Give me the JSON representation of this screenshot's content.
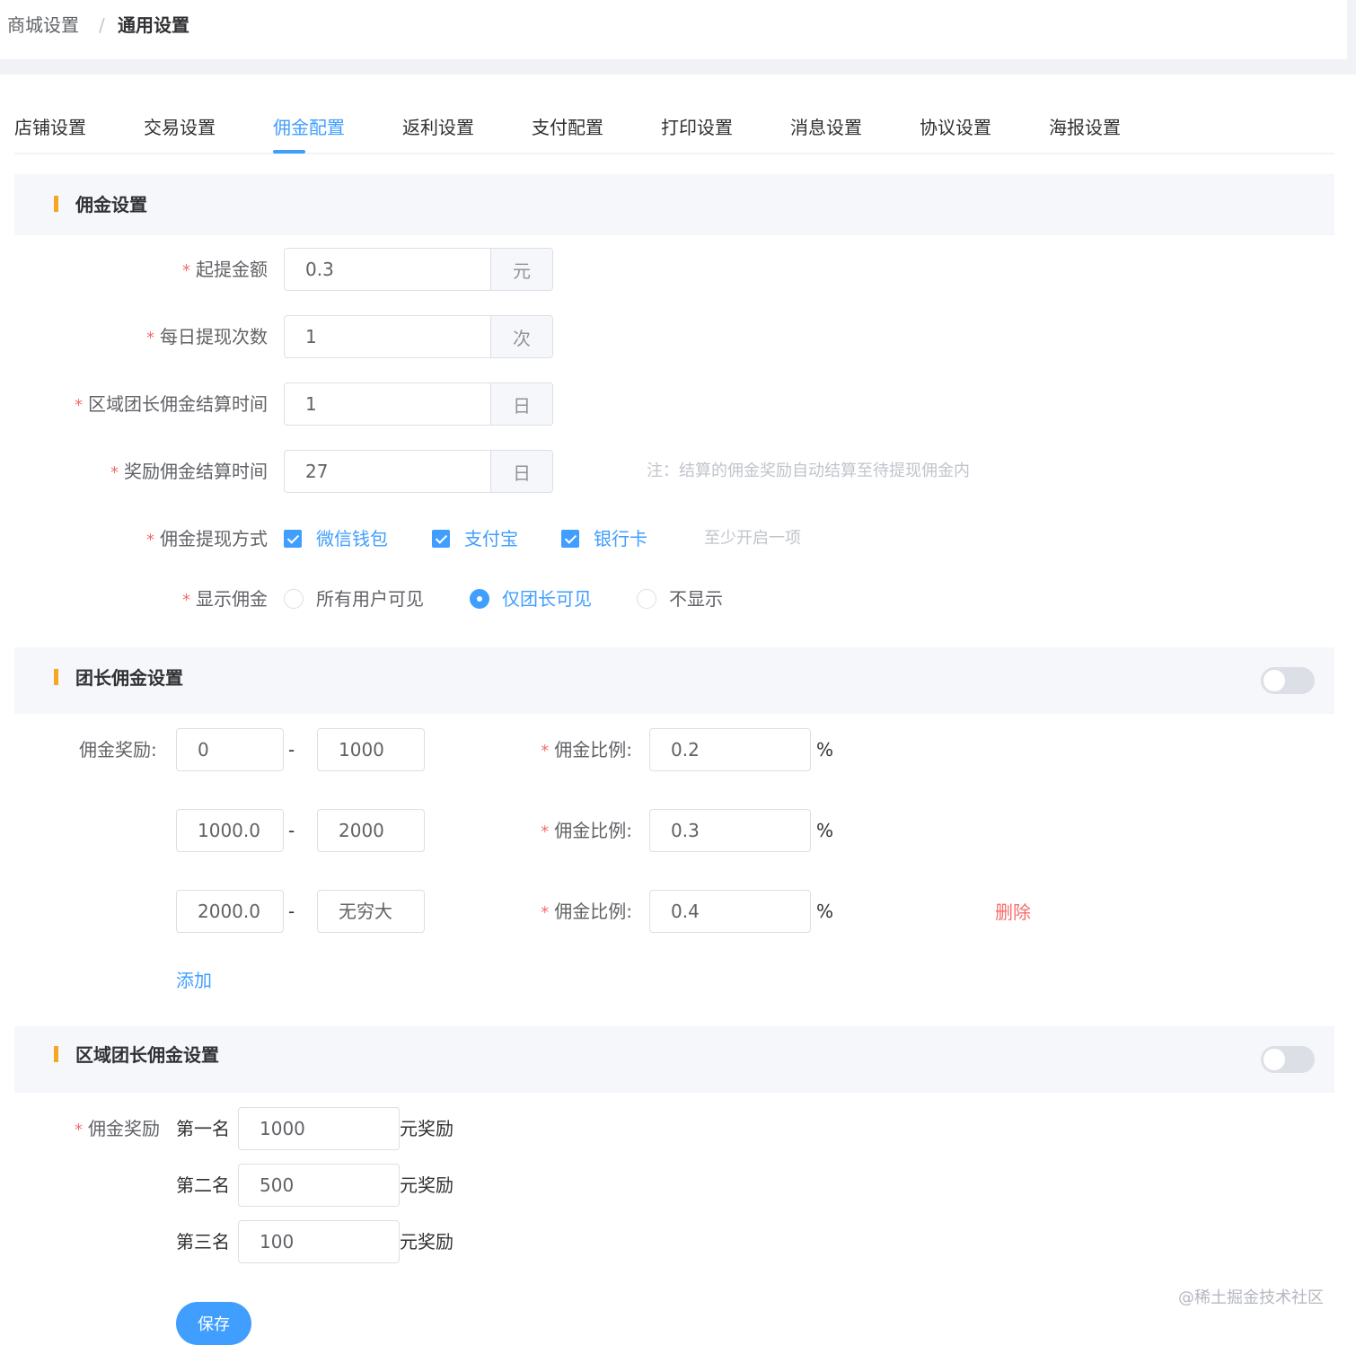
{
  "breadcrumb": {
    "parent": "商城设置",
    "separator": "/",
    "current": "通用设置"
  },
  "tabs": [
    "店铺设置",
    "交易设置",
    "佣金配置",
    "返利设置",
    "支付配置",
    "打印设置",
    "消息设置",
    "协议设置",
    "海报设置"
  ],
  "active_tab": "佣金配置",
  "commission": {
    "title": "佣金设置",
    "required_mark": "*",
    "min_withdraw": {
      "label": "起提金额",
      "value": "0.3",
      "unit": "元"
    },
    "daily_times": {
      "label": "每日提现次数",
      "value": "1",
      "unit": "次"
    },
    "region_settle": {
      "label": "区域团长佣金结算时间",
      "value": "1",
      "unit": "日"
    },
    "reward_settle": {
      "label": "奖励佣金结算时间",
      "value": "27",
      "unit": "日",
      "note": "注：结算的佣金奖励自动结算至待提现佣金内"
    },
    "withdraw_method": {
      "label": "佣金提现方式",
      "options": [
        "微信钱包",
        "支付宝",
        "银行卡"
      ],
      "checked": [
        true,
        true,
        true
      ],
      "hint": "至少开启一项"
    },
    "display": {
      "label": "显示佣金",
      "options": [
        "所有用户可见",
        "仅团长可见",
        "不显示"
      ],
      "selected": "仅团长可见"
    }
  },
  "leader": {
    "title": "团长佣金设置",
    "enabled": false,
    "reward_label": "佣金奖励:",
    "dash": "-",
    "rate_label": "佣金比例:",
    "percent": "%",
    "tiers": [
      {
        "min": "0",
        "max": "1000",
        "rate": "0.2"
      },
      {
        "min": "1000.01",
        "max": "2000",
        "rate": "0.3"
      },
      {
        "min": "2000.01",
        "max": "",
        "max_placeholder": "无穷大",
        "rate": "0.4"
      }
    ],
    "delete_label": "删除",
    "add_label": "添加"
  },
  "region": {
    "title": "区域团长佣金设置",
    "enabled": false,
    "reward_label": "佣金奖励",
    "ranks": [
      {
        "label": "第一名",
        "value": "1000"
      },
      {
        "label": "第二名",
        "value": "500"
      },
      {
        "label": "第三名",
        "value": "100"
      }
    ],
    "suffix": "元奖励"
  },
  "save_label": "保存",
  "watermark": "@稀土掘金技术社区",
  "colors": {
    "primary": "#409eff",
    "danger": "#f56c6c",
    "accent_bar": "#f5a623",
    "section_bg": "#f5f7fa"
  }
}
